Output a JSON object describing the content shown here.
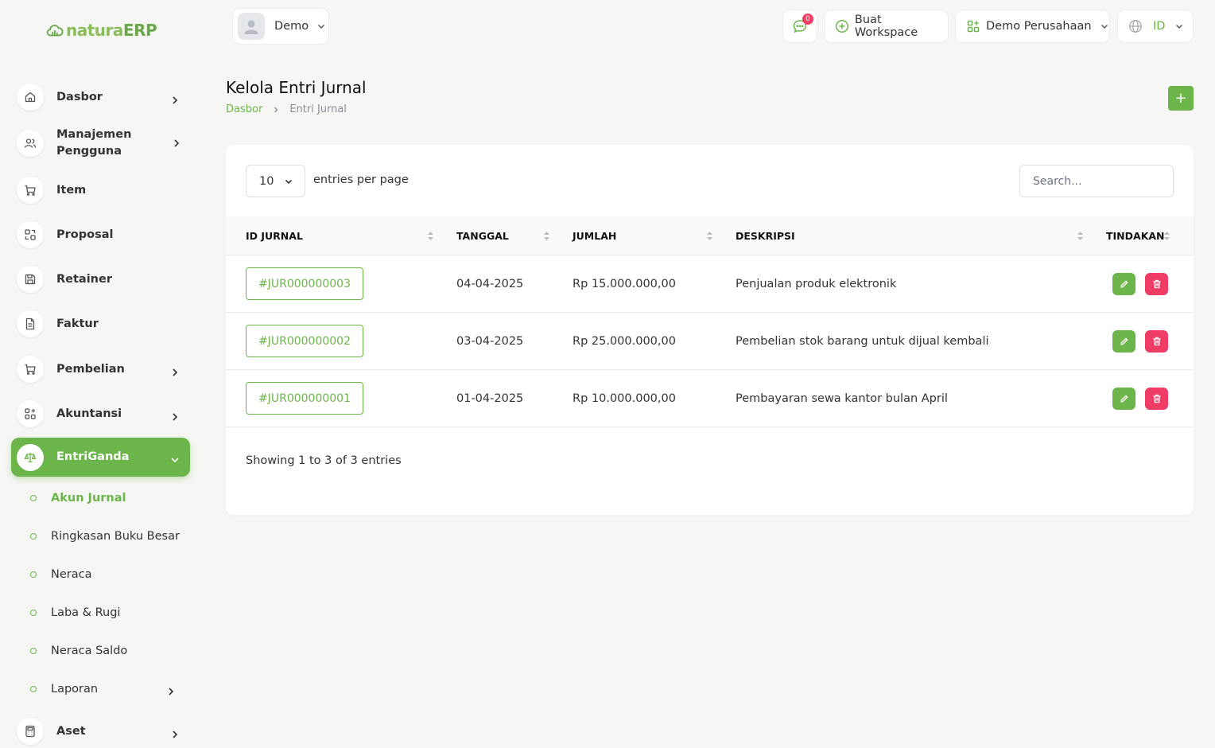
{
  "app": {
    "brand_part1": "natura",
    "brand_part2": "ERP",
    "accent_color": "#6cb54a",
    "danger_color": "#ef3d66"
  },
  "sidebar": {
    "items": [
      {
        "label": "Dasbor",
        "icon": "home-icon"
      },
      {
        "label": "Manajemen Pengguna",
        "icon": "users-icon"
      },
      {
        "label": "Item",
        "icon": "cart-icon"
      },
      {
        "label": "Proposal",
        "icon": "swap-icon"
      },
      {
        "label": "Retainer",
        "icon": "save-icon"
      },
      {
        "label": "Faktur",
        "icon": "document-icon"
      },
      {
        "label": "Pembelian",
        "icon": "cart-icon"
      },
      {
        "label": "Akuntansi",
        "icon": "grid-icon"
      },
      {
        "label": "EntriGanda",
        "icon": "scale-icon"
      },
      {
        "label": "Aset",
        "icon": "calculator-icon"
      }
    ],
    "subitems": [
      {
        "label": "Akun Jurnal"
      },
      {
        "label": "Ringkasan Buku Besar"
      },
      {
        "label": "Neraca"
      },
      {
        "label": "Laba & Rugi"
      },
      {
        "label": "Neraca Saldo"
      },
      {
        "label": "Laporan"
      }
    ]
  },
  "header": {
    "user_name": "Demo",
    "notification_count": "0",
    "create_workspace": "Buat Workspace",
    "company": "Demo Perusahaan",
    "language": "ID"
  },
  "page": {
    "title": "Kelola Entri Jurnal",
    "breadcrumb_home": "Dasbor",
    "breadcrumb_current": "Entri Jurnal",
    "add_label": "+"
  },
  "table": {
    "per_page": "10",
    "per_page_label": "entries per page",
    "search_placeholder": "Search...",
    "columns": [
      "ID JURNAL",
      "TANGGAL",
      "JUMLAH",
      "DESKRIPSI",
      "TINDAKAN"
    ],
    "rows": [
      {
        "id": "#JUR000000003",
        "date": "04-04-2025",
        "amount": "Rp 15.000.000,00",
        "desc": "Penjualan produk elektronik"
      },
      {
        "id": "#JUR000000002",
        "date": "03-04-2025",
        "amount": "Rp 25.000.000,00",
        "desc": "Pembelian stok barang untuk dijual kembali"
      },
      {
        "id": "#JUR000000001",
        "date": "01-04-2025",
        "amount": "Rp 10.000.000,00",
        "desc": "Pembayaran sewa kantor bulan April"
      }
    ],
    "footer": "Showing 1 to 3 of 3 entries"
  }
}
